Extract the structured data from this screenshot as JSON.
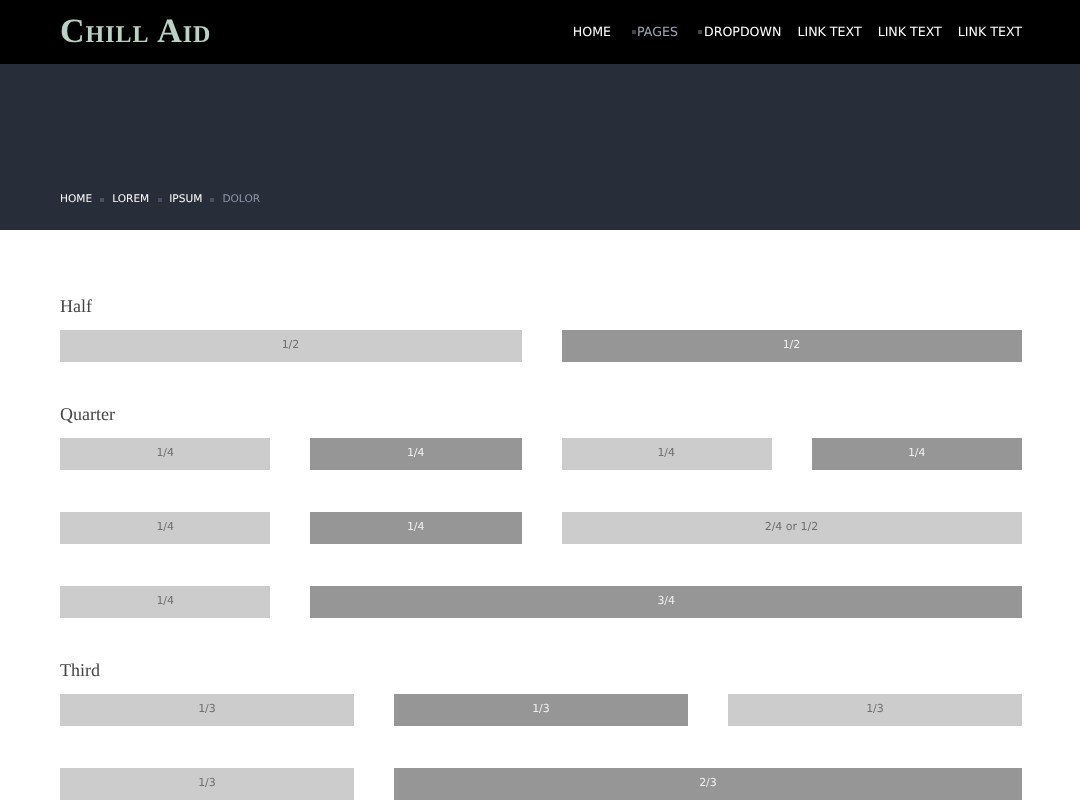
{
  "logo": "Chill Aid",
  "nav": [
    {
      "label": "HOME",
      "selected": false,
      "dropdown": false
    },
    {
      "label": "PAGES",
      "selected": true,
      "dropdown": true
    },
    {
      "label": "DROPDOWN",
      "selected": false,
      "dropdown": true
    },
    {
      "label": "LINK TEXT",
      "selected": false,
      "dropdown": false
    },
    {
      "label": "LINK TEXT",
      "selected": false,
      "dropdown": false
    },
    {
      "label": "LINK TEXT",
      "selected": false,
      "dropdown": false
    }
  ],
  "breadcrumb": [
    {
      "label": "HOME",
      "selected": false
    },
    {
      "label": "LOREM",
      "selected": false
    },
    {
      "label": "IPSUM",
      "selected": false
    },
    {
      "label": "DOLOR",
      "selected": true
    }
  ],
  "sections": [
    {
      "title": "Half",
      "rows": [
        [
          {
            "label": "1/2",
            "kind": "half",
            "color": "#cccccc"
          },
          {
            "label": "1/2",
            "kind": "half",
            "color": "#969696"
          }
        ]
      ]
    },
    {
      "title": "Quarter",
      "rows": [
        [
          {
            "label": "1/4",
            "kind": "quarter",
            "color": "#cccccc"
          },
          {
            "label": "1/4",
            "kind": "quarter",
            "color": "#969696"
          },
          {
            "label": "1/4",
            "kind": "quarter",
            "color": "#cccccc"
          },
          {
            "label": "1/4",
            "kind": "quarter",
            "color": "#969696"
          }
        ],
        [
          {
            "label": "1/4",
            "kind": "quarter",
            "color": "#cccccc"
          },
          {
            "label": "1/4",
            "kind": "quarter",
            "color": "#969696"
          },
          {
            "label": "2/4 or 1/2",
            "kind": "half",
            "color": "#cccccc"
          }
        ],
        [
          {
            "label": "1/4",
            "kind": "quarter",
            "color": "#cccccc"
          },
          {
            "label": "3/4",
            "kind": "three-quarters",
            "color": "#969696"
          }
        ]
      ]
    },
    {
      "title": "Third",
      "rows": [
        [
          {
            "label": "1/3",
            "kind": "third",
            "color": "#cccccc"
          },
          {
            "label": "1/3",
            "kind": "third",
            "color": "#969696"
          },
          {
            "label": "1/3",
            "kind": "third",
            "color": "#cccccc"
          }
        ],
        [
          {
            "label": "1/3",
            "kind": "third",
            "color": "#cccccc"
          },
          {
            "label": "2/3",
            "kind": "two-thirds",
            "color": "#969696"
          }
        ]
      ]
    }
  ]
}
